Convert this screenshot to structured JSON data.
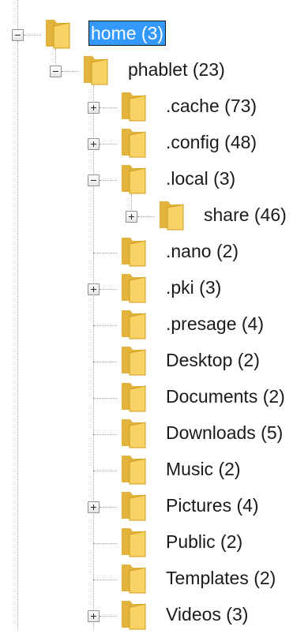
{
  "tree": {
    "root": {
      "label": "home (3)",
      "expanded": true,
      "selected": true,
      "children": [
        {
          "label": "phablet (23)",
          "expanded": true,
          "children": [
            {
              "label": ".cache (73)",
              "has_children": true,
              "expanded": false
            },
            {
              "label": ".config (48)",
              "has_children": true,
              "expanded": false
            },
            {
              "label": ".local (3)",
              "has_children": true,
              "expanded": true,
              "children": [
                {
                  "label": "share (46)",
                  "has_children": true,
                  "expanded": false
                }
              ]
            },
            {
              "label": ".nano (2)",
              "has_children": false
            },
            {
              "label": ".pki (3)",
              "has_children": true,
              "expanded": false
            },
            {
              "label": ".presage (4)",
              "has_children": false
            },
            {
              "label": "Desktop (2)",
              "has_children": false
            },
            {
              "label": "Documents (2)",
              "has_children": false
            },
            {
              "label": "Downloads (5)",
              "has_children": false
            },
            {
              "label": "Music (2)",
              "has_children": false
            },
            {
              "label": "Pictures (4)",
              "has_children": true,
              "expanded": false
            },
            {
              "label": "Public (2)",
              "has_children": false
            },
            {
              "label": "Templates (2)",
              "has_children": false
            },
            {
              "label": "Videos (3)",
              "has_children": true,
              "expanded": false
            }
          ]
        }
      ]
    }
  },
  "colors": {
    "selection": "#3399ff",
    "folder_back": "#e2b33a",
    "folder_front": "#f7d264"
  },
  "icons": {
    "folder": "folder-icon",
    "expand": "plus-icon",
    "collapse": "minus-icon"
  }
}
